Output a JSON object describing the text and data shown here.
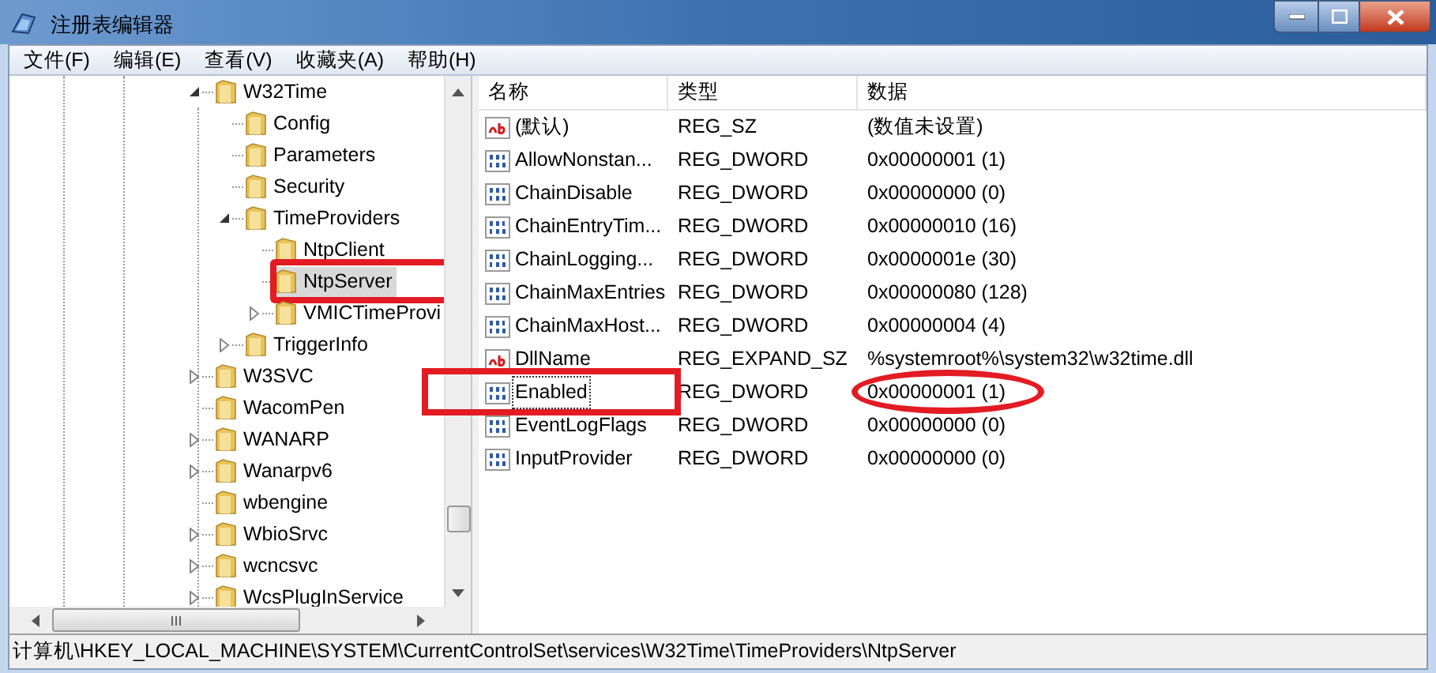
{
  "window": {
    "title": "注册表编辑器"
  },
  "menu": [
    "文件(F)",
    "编辑(E)",
    "查看(V)",
    "收藏夹(A)",
    "帮助(H)"
  ],
  "tree": [
    {
      "label": "W32Time",
      "expandable": true,
      "expanded": true,
      "selected": false,
      "highlighted": false,
      "children": [
        {
          "label": "Config",
          "expandable": false,
          "selected": false,
          "highlighted": false
        },
        {
          "label": "Parameters",
          "expandable": false,
          "selected": false,
          "highlighted": false
        },
        {
          "label": "Security",
          "expandable": false,
          "selected": false,
          "highlighted": false
        },
        {
          "label": "TimeProviders",
          "expandable": true,
          "expanded": true,
          "selected": false,
          "highlighted": false,
          "children": [
            {
              "label": "NtpClient",
              "expandable": false,
              "selected": false,
              "highlighted": false
            },
            {
              "label": "NtpServer",
              "expandable": false,
              "selected": true,
              "highlighted": true
            },
            {
              "label": "VMICTimeProvi",
              "expandable": true,
              "expanded": false,
              "selected": false,
              "highlighted": false
            }
          ]
        },
        {
          "label": "TriggerInfo",
          "expandable": true,
          "expanded": false,
          "selected": false,
          "highlighted": false
        }
      ]
    },
    {
      "label": "W3SVC",
      "expandable": true,
      "expanded": false,
      "selected": false,
      "highlighted": false
    },
    {
      "label": "WacomPen",
      "expandable": false,
      "selected": false,
      "highlighted": false
    },
    {
      "label": "WANARP",
      "expandable": true,
      "expanded": false,
      "selected": false,
      "highlighted": false
    },
    {
      "label": "Wanarpv6",
      "expandable": true,
      "expanded": false,
      "selected": false,
      "highlighted": false
    },
    {
      "label": "wbengine",
      "expandable": false,
      "selected": false,
      "highlighted": false
    },
    {
      "label": "WbioSrvc",
      "expandable": true,
      "expanded": false,
      "selected": false,
      "highlighted": false
    },
    {
      "label": "wcncsvc",
      "expandable": true,
      "expanded": false,
      "selected": false,
      "highlighted": false
    },
    {
      "label": "WcsPlugInService",
      "expandable": true,
      "expanded": false,
      "selected": false,
      "highlighted": false
    }
  ],
  "list": {
    "columns": [
      "名称",
      "类型",
      "数据"
    ],
    "rows": [
      {
        "kind": "string",
        "name": "(默认)",
        "type": "REG_SZ",
        "data": "(数值未设置)",
        "focused": false,
        "highlighted": false,
        "data_circled": false
      },
      {
        "kind": "binary",
        "name": "AllowNonstan...",
        "type": "REG_DWORD",
        "data": "0x00000001 (1)",
        "focused": false,
        "highlighted": false,
        "data_circled": false
      },
      {
        "kind": "binary",
        "name": "ChainDisable",
        "type": "REG_DWORD",
        "data": "0x00000000 (0)",
        "focused": false,
        "highlighted": false,
        "data_circled": false
      },
      {
        "kind": "binary",
        "name": "ChainEntryTim...",
        "type": "REG_DWORD",
        "data": "0x00000010 (16)",
        "focused": false,
        "highlighted": false,
        "data_circled": false
      },
      {
        "kind": "binary",
        "name": "ChainLogging...",
        "type": "REG_DWORD",
        "data": "0x0000001e (30)",
        "focused": false,
        "highlighted": false,
        "data_circled": false
      },
      {
        "kind": "binary",
        "name": "ChainMaxEntries",
        "type": "REG_DWORD",
        "data": "0x00000080 (128)",
        "focused": false,
        "highlighted": false,
        "data_circled": false
      },
      {
        "kind": "binary",
        "name": "ChainMaxHost...",
        "type": "REG_DWORD",
        "data": "0x00000004 (4)",
        "focused": false,
        "highlighted": false,
        "data_circled": false
      },
      {
        "kind": "string",
        "name": "DllName",
        "type": "REG_EXPAND_SZ",
        "data": "%systemroot%\\system32\\w32time.dll",
        "focused": false,
        "highlighted": false,
        "data_circled": false
      },
      {
        "kind": "binary",
        "name": "Enabled",
        "type": "REG_DWORD",
        "data": "0x00000001 (1)",
        "focused": true,
        "highlighted": true,
        "data_circled": true
      },
      {
        "kind": "binary",
        "name": "EventLogFlags",
        "type": "REG_DWORD",
        "data": "0x00000000 (0)",
        "focused": false,
        "highlighted": false,
        "data_circled": false
      },
      {
        "kind": "binary",
        "name": "InputProvider",
        "type": "REG_DWORD",
        "data": "0x00000000 (0)",
        "focused": false,
        "highlighted": false,
        "data_circled": false
      }
    ]
  },
  "status_bar": "计算机\\HKEY_LOCAL_MACHINE\\SYSTEM\\CurrentControlSet\\services\\W32Time\\TimeProviders\\NtpServer"
}
